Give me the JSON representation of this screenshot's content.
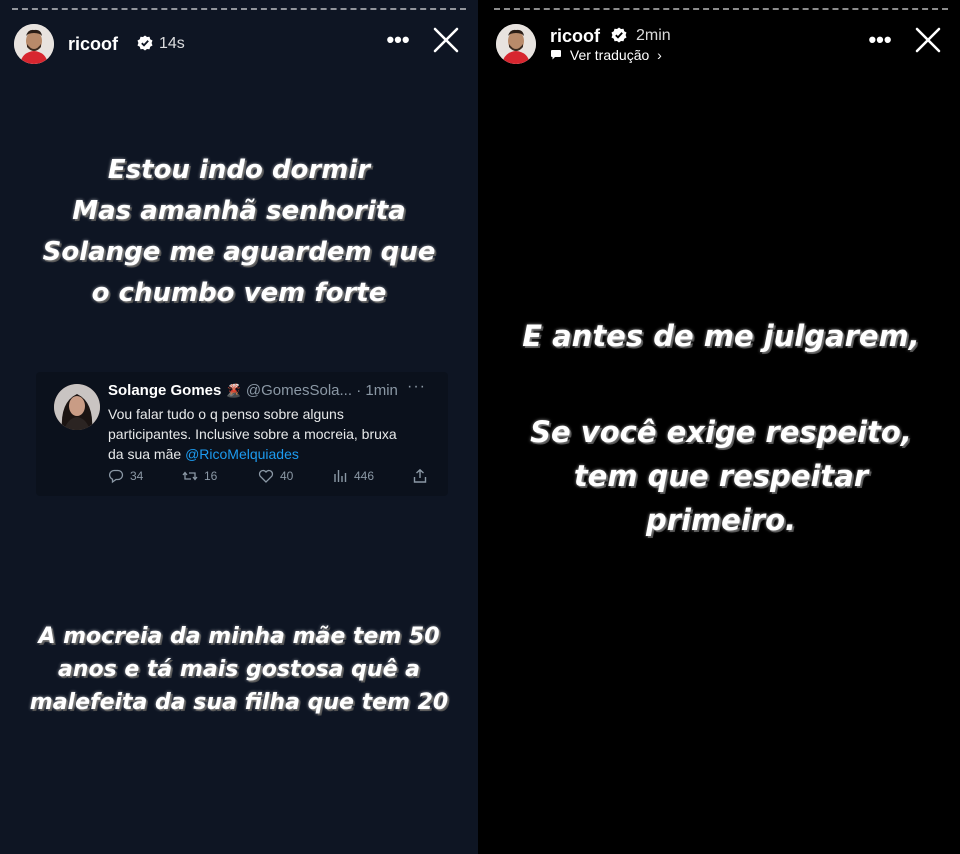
{
  "left_story": {
    "username": "ricoof",
    "time": "14s",
    "text_top": [
      "Estou indo dormir",
      "Mas amanhã senhorita",
      "Solange me aguardem que",
      "o chumbo vem forte"
    ],
    "tweet": {
      "name": "Solange Gomes",
      "handle": "@GomesSola...",
      "time": "· 1min",
      "body": "Vou falar tudo o q penso sobre alguns participantes. Inclusive sobre a mocreia, bruxa da sua mãe ",
      "mention": "@RicoMelquiades",
      "replies": "34",
      "retweets": "16",
      "likes": "40",
      "views": "446"
    },
    "text_bottom": [
      "A mocreia da minha mãe tem 50",
      "anos e tá mais gostosa quê a",
      "malefeita da sua filha que tem 20"
    ]
  },
  "right_story": {
    "username": "ricoof",
    "time": "2min",
    "translate": "Ver tradução",
    "text_1": "E antes de me julgarem,",
    "text_2": [
      "Se você exige respeito,",
      "tem que respeitar",
      "primeiro."
    ]
  },
  "colors": {
    "left_bg": "#0e1523",
    "right_bg": "#000000",
    "link": "#1d9bf0"
  }
}
